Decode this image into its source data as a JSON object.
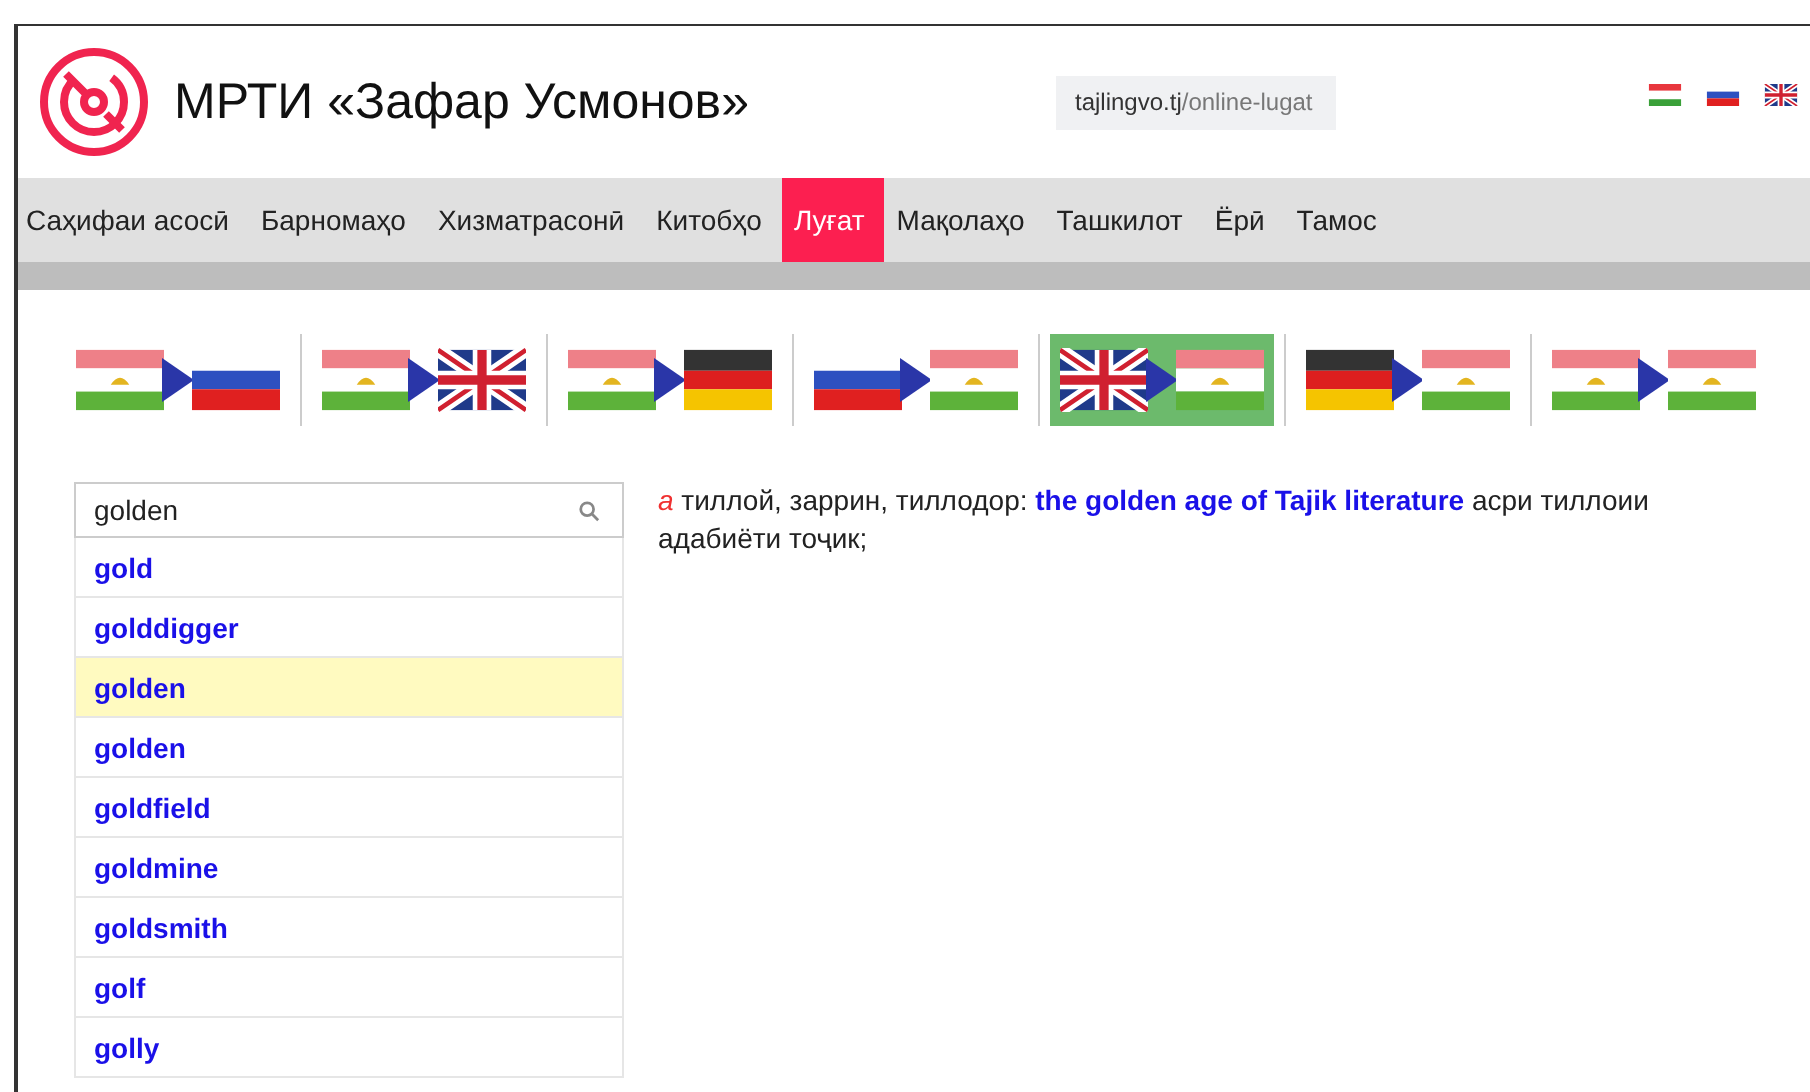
{
  "header": {
    "title": "МРТИ «Зафар Усмонов»",
    "url_domain": "tajlingvo.tj",
    "url_path": "/online-lugat",
    "languages": [
      {
        "kind": "tj"
      },
      {
        "kind": "ru"
      },
      {
        "kind": "gb"
      }
    ]
  },
  "nav": [
    {
      "label": "Саҳифаи асосӣ",
      "selected": false
    },
    {
      "label": "Барномаҳо",
      "selected": false
    },
    {
      "label": "Хизматрасонӣ",
      "selected": false
    },
    {
      "label": "Китобҳо",
      "selected": false
    },
    {
      "label": "Луғат",
      "selected": true
    },
    {
      "label": "Мақолаҳо",
      "selected": false
    },
    {
      "label": "Ташкилот",
      "selected": false
    },
    {
      "label": "Ёрӣ",
      "selected": false
    },
    {
      "label": "Тамос",
      "selected": false
    }
  ],
  "directions": [
    {
      "flags": [
        {
          "kind": "tj"
        },
        {
          "kind": "ru"
        }
      ],
      "selected": false
    },
    {
      "flags": [
        {
          "kind": "tj"
        },
        {
          "kind": "gb"
        }
      ],
      "selected": false
    },
    {
      "flags": [
        {
          "kind": "tj"
        },
        {
          "kind": "de"
        }
      ],
      "selected": false
    },
    {
      "flags": [
        {
          "kind": "ru"
        },
        {
          "kind": "tj"
        }
      ],
      "selected": false
    },
    {
      "flags": [
        {
          "kind": "gb"
        },
        {
          "kind": "tj"
        }
      ],
      "selected": true
    },
    {
      "flags": [
        {
          "kind": "de"
        },
        {
          "kind": "tj"
        }
      ],
      "selected": false
    },
    {
      "flags": [
        {
          "kind": "tj"
        },
        {
          "kind": "tj"
        }
      ],
      "selected": false
    }
  ],
  "search": {
    "value": "golden"
  },
  "words": [
    {
      "label": "gold",
      "selected": false
    },
    {
      "label": "golddigger",
      "selected": false
    },
    {
      "label": "golden",
      "selected": true
    },
    {
      "label": "golden",
      "selected": false
    },
    {
      "label": "goldfield",
      "selected": false
    },
    {
      "label": "goldmine",
      "selected": false
    },
    {
      "label": "goldsmith",
      "selected": false
    },
    {
      "label": "golf",
      "selected": false
    },
    {
      "label": "golly",
      "selected": false
    }
  ],
  "entry": {
    "definition": "*a* тиллой, заррин, тиллодор: **the golden age of Tajik literature** асри тиллоии адабиёти тоҷик;"
  }
}
